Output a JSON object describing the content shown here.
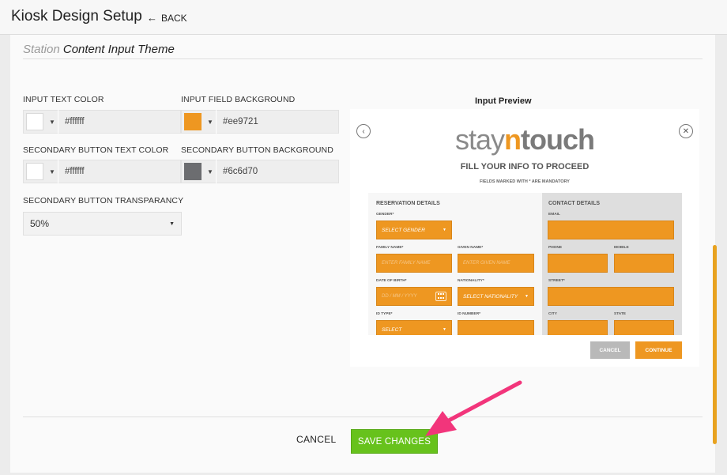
{
  "header": {
    "title": "Kiosk Design Setup",
    "back_label": "BACK"
  },
  "section": {
    "title_muted": "Station",
    "title_main": "Content Input Theme"
  },
  "fields": {
    "input_text_color": {
      "label": "INPUT TEXT COLOR",
      "value": "#ffffff",
      "swatch": "#ffffff"
    },
    "input_field_background": {
      "label": "INPUT FIELD BACKGROUND",
      "value": "#ee9721",
      "swatch": "#ee9721"
    },
    "secondary_button_text_color": {
      "label": "SECONDARY BUTTON TEXT COLOR",
      "value": "#ffffff",
      "swatch": "#ffffff"
    },
    "secondary_button_background": {
      "label": "SECONDARY BUTTON BACKGROUND",
      "value": "#6c6d70",
      "swatch": "#6c6d70"
    },
    "secondary_button_transparancy": {
      "label": "SECONDARY BUTTON TRANSPARANCY",
      "value": "50%"
    }
  },
  "preview": {
    "title": "Input Preview",
    "logo_stay": "stay",
    "logo_n": "n",
    "logo_touch": "touch",
    "heading": "FILL YOUR INFO TO PROCEED",
    "note": "FIELDS MARKED WITH * ARE MANDATORY",
    "reservation_title": "RESERVATION DETAILS",
    "contact_title": "CONTACT DETAILS",
    "labels": {
      "gender": "GENDER*",
      "family_name": "FAMILY NAME*",
      "given_name": "GIVEN NAME*",
      "date_of_birth": "DATE OF BIRTH*",
      "nationality": "NATIONALITY*",
      "id_type": "ID TYPE*",
      "id_number": "ID NUMBER*",
      "email": "EMAIL",
      "phone": "PHONE",
      "mobile": "MOBILE",
      "street": "STREET*",
      "city": "CITY",
      "state": "STATE"
    },
    "placeholders": {
      "gender": "SELECT GENDER",
      "family_name": "ENTER FAMILY NAME",
      "given_name": "ENTER GIVEN NAME",
      "dob": "DD / MM / YYYY",
      "nationality": "SELECT NATIONALITY",
      "id_type": "SELECT"
    },
    "cancel_label": "CANCEL",
    "continue_label": "CONTINUE",
    "secondary_button_color": "#b9b9b9",
    "primary_button_color": "#ee9721"
  },
  "footer": {
    "cancel_label": "CANCEL",
    "save_label": "SAVE CHANGES"
  },
  "colors": {
    "accent_green": "#67c21c",
    "annotation_arrow": "#f2357b",
    "scrollbar": "#e8a21f"
  }
}
